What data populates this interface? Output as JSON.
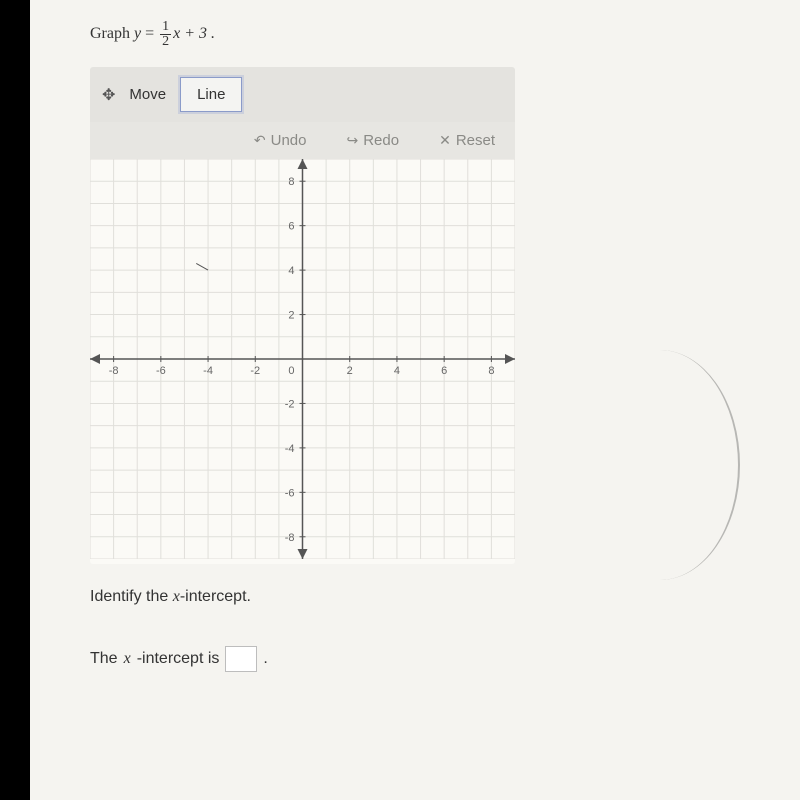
{
  "problem": {
    "prefix": "Graph ",
    "var_y": "y",
    "equals": " = ",
    "frac_num": "1",
    "frac_den": "2",
    "after_frac": "x + 3 ."
  },
  "toolbar": {
    "move_label": "Move",
    "line_label": "Line"
  },
  "actions": {
    "undo_label": "Undo",
    "redo_label": "Redo",
    "reset_label": "Reset"
  },
  "chart_data": {
    "type": "line",
    "title": "",
    "series": [],
    "x_ticks": [
      -8,
      -6,
      -4,
      -2,
      0,
      2,
      4,
      6,
      8
    ],
    "y_ticks": [
      -8,
      -6,
      -4,
      -2,
      2,
      4,
      6,
      8
    ],
    "xlim": [
      -9,
      9
    ],
    "ylim": [
      -9,
      9
    ],
    "grid": true,
    "zero_label": "0"
  },
  "question": {
    "identify_text_pre": "Identify the ",
    "identify_text_post": "-intercept.",
    "answer_pre": "The ",
    "answer_post": "-intercept is ",
    "x_label": "x"
  }
}
